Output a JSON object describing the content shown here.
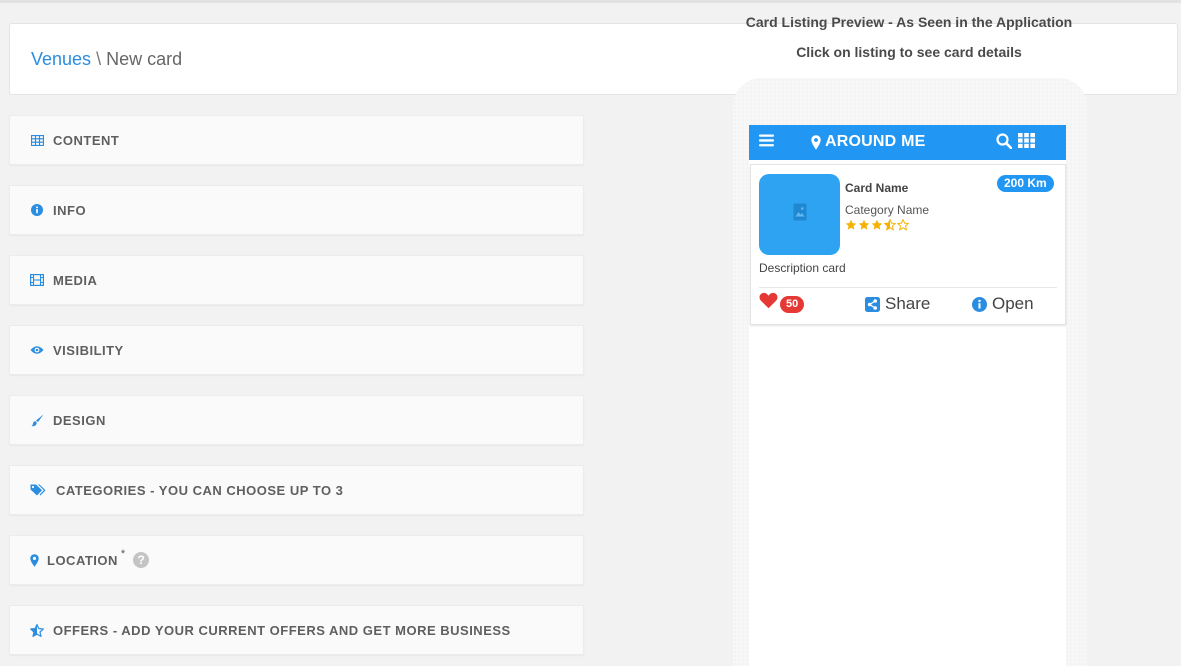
{
  "breadcrumb": {
    "parent": "Venues",
    "separator": "\\",
    "current": "New card"
  },
  "sections": [
    {
      "label": "CONTENT",
      "icon": "table-icon"
    },
    {
      "label": "INFO",
      "icon": "info-circle-icon"
    },
    {
      "label": "MEDIA",
      "icon": "film-icon"
    },
    {
      "label": "VISIBILITY",
      "icon": "eye-icon"
    },
    {
      "label": "DESIGN",
      "icon": "paint-brush-icon"
    },
    {
      "label": "CATEGORIES - YOU CAN CHOOSE UP TO 3",
      "icon": "tags-icon"
    },
    {
      "label": "LOCATION",
      "icon": "map-marker-icon",
      "required_mark": "*",
      "help": "?"
    },
    {
      "label": "OFFERS - ADD YOUR CURRENT OFFERS AND GET MORE BUSINESS",
      "icon": "star-half-icon"
    }
  ],
  "preview": {
    "title": "Card Listing Preview - As Seen in the Application",
    "subtitle": "Click on listing to see card details"
  },
  "app_bar": {
    "title": "AROUND ME"
  },
  "card": {
    "name": "Card Name",
    "category": "Category Name",
    "rating": 3.5,
    "rating_max": 5,
    "distance": "200 Km",
    "description": "Description card",
    "likes": "50",
    "share_label": "Share",
    "open_label": "Open"
  },
  "colors": {
    "accent": "#2196f3",
    "link": "#2b8de0",
    "star": "#f5b301",
    "heart": "#e53935"
  }
}
